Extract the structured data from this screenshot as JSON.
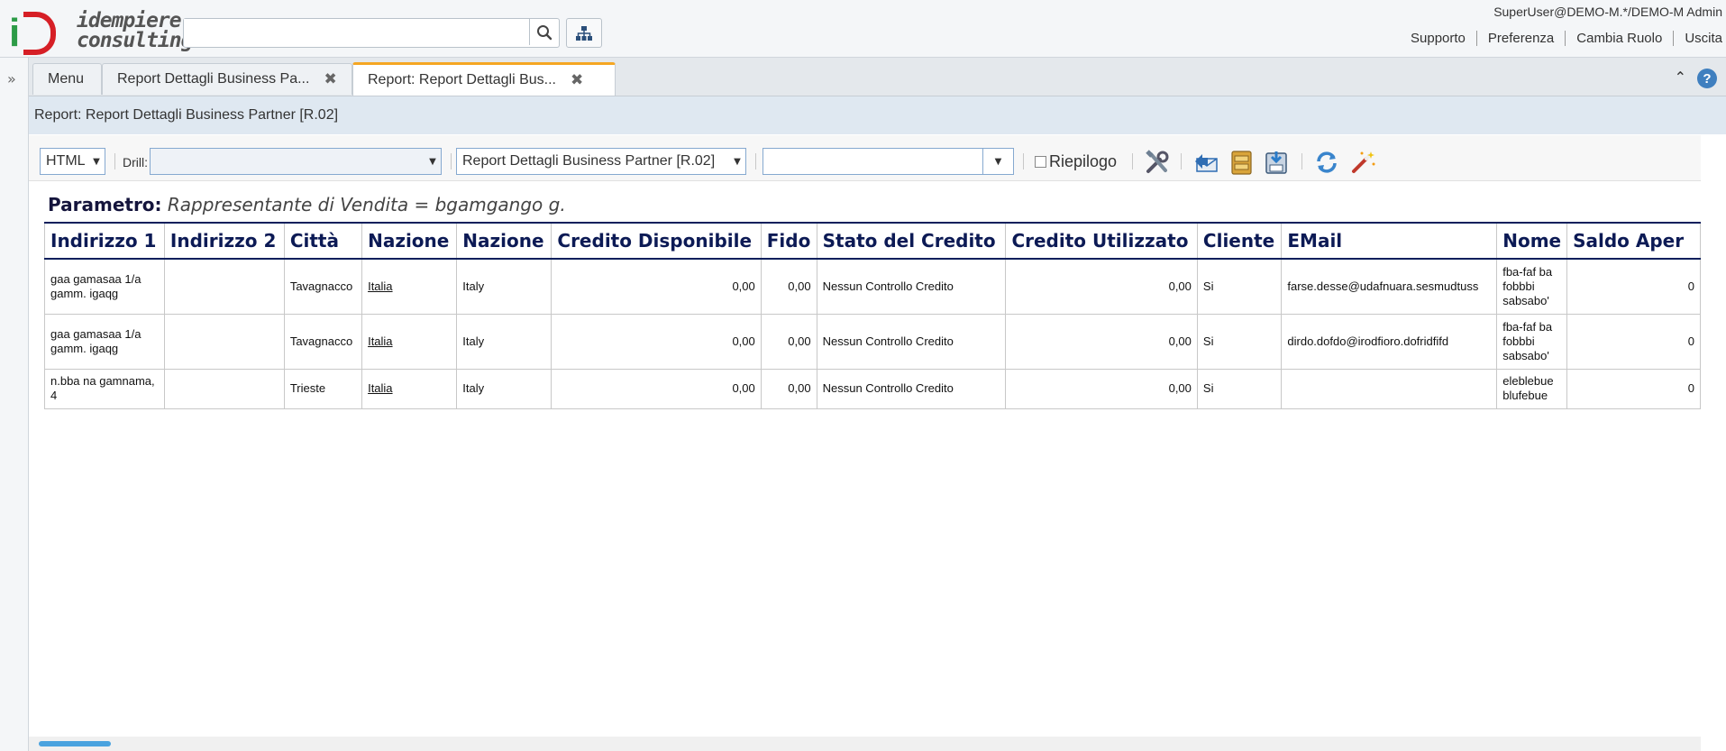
{
  "header": {
    "logo_line1": "idempiere",
    "logo_line2": "consulting",
    "search_placeholder": "",
    "user": "SuperUser@DEMO-M.*/DEMO-M Admin",
    "links": [
      "Supporto",
      "Preferenza",
      "Cambia Ruolo",
      "Uscita"
    ]
  },
  "tabs": [
    {
      "label": "Menu",
      "closable": false
    },
    {
      "label": "Report Dettagli Business Pa...",
      "closable": true
    },
    {
      "label": "Report: Report Dettagli Bus...",
      "closable": true,
      "active": true
    }
  ],
  "breadcrumb": "Report: Report Dettagli Business Partner [R.02]",
  "toolbar": {
    "format": "HTML",
    "drill_label": "Drill:",
    "drill_value": "",
    "print_format": "Report Dettagli Business Partner [R.02]",
    "extra_value": "",
    "summary_label": "Riepilogo",
    "buttons": [
      "customize-icon",
      "send-mail-icon",
      "archive-icon",
      "export-icon",
      "refresh-icon",
      "wizard-icon"
    ]
  },
  "report": {
    "param_label": "Parametro:",
    "param_value": "Rappresentante di Vendita = bgamgango g.",
    "columns": [
      "Indirizzo 1",
      "Indirizzo 2",
      "Città",
      "Nazione",
      "Nazione",
      "Credito Disponibile",
      "Fido",
      "Stato del Credito",
      "Credito Utilizzato",
      "Cliente",
      "EMail",
      "Nome",
      "Saldo Aper"
    ],
    "rows": [
      [
        "gaa gamasaa 1/a gamm. igaqg",
        "",
        "Tavagnacco",
        "Italia",
        "Italy",
        "0,00",
        "0,00",
        "Nessun Controllo Credito",
        "0,00",
        "Si",
        "farse.desse@udafnuara.sesmudtuss",
        "fba-faf ba fobbbi sabsabo'",
        "0"
      ],
      [
        "gaa gamasaa 1/a gamm. igaqg",
        "",
        "Tavagnacco",
        "Italia",
        "Italy",
        "0,00",
        "0,00",
        "Nessun Controllo Credito",
        "0,00",
        "Si",
        "dirdo.dofdo@irodfioro.dofridfifd",
        "fba-faf ba fobbbi sabsabo'",
        "0"
      ],
      [
        "n.bba na gamnama, 4",
        "",
        "Trieste",
        "Italia",
        "Italy",
        "0,00",
        "0,00",
        "Nessun Controllo Credito",
        "0,00",
        "Si",
        "",
        "eleblebue blufebue",
        "0"
      ]
    ]
  }
}
